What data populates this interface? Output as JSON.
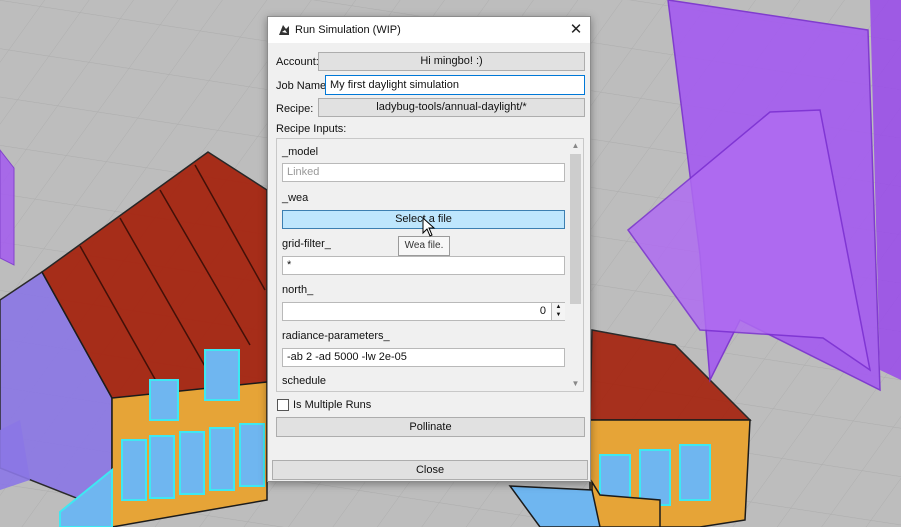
{
  "dialog": {
    "title": "Run Simulation (WIP)",
    "close_glyph": "✕",
    "account_label": "Account:",
    "account_value": "Hi mingbo! :)",
    "job_name_label": "Job Name:",
    "job_name_value": "My first daylight simulation",
    "recipe_label": "Recipe:",
    "recipe_value": "ladybug-tools/annual-daylight/*",
    "recipe_inputs_label": "Recipe Inputs:",
    "inputs": {
      "model_label": "_model",
      "model_placeholder": "Linked",
      "wea_label": "_wea",
      "wea_button": "Select a file",
      "wea_tooltip": "Wea file.",
      "grid_filter_label": "grid-filter_",
      "grid_filter_value": "*",
      "north_label": "north_",
      "north_value": "0",
      "radiance_label": "radiance-parameters_",
      "radiance_value": "-ab 2 -ad 5000 -lw 2e-05",
      "schedule_label": "schedule"
    },
    "multiple_runs_label": "Is Multiple Runs",
    "pollinate_button": "Pollinate",
    "close_button": "Close"
  },
  "colors": {
    "accent": "#0078d7",
    "selected_button": "#bee6fd",
    "purple_geometry": "#a45bf0",
    "roof_red": "#a5210c",
    "wall_orange": "#e6a437",
    "glass_cyan": "#3ee8f2"
  },
  "icons": {
    "app": "app-logo-icon",
    "close": "close-icon",
    "cursor": "mouse-cursor-icon"
  }
}
